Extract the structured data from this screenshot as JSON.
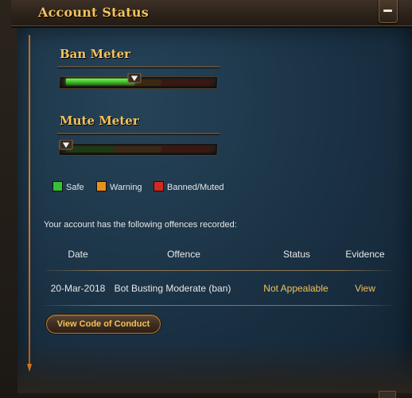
{
  "header": {
    "title": "Account Status"
  },
  "ban_meter": {
    "title": "Ban Meter",
    "level": 0.47
  },
  "mute_meter": {
    "title": "Mute Meter",
    "level": 0.0
  },
  "legend": [
    {
      "label": "Safe",
      "color": "#33c233"
    },
    {
      "label": "Warning",
      "color": "#e8921c"
    },
    {
      "label": "Banned/Muted",
      "color": "#d12a20"
    }
  ],
  "offences_text": "Your account has the following offences recorded:",
  "table": {
    "headers": [
      "Date",
      "Offence",
      "Status",
      "Evidence"
    ],
    "rows": [
      {
        "date": "20-Mar-2018",
        "offence": "Bot Busting Moderate (ban)",
        "status": "Not Appealable",
        "evidence": "View"
      }
    ]
  },
  "colors": {
    "accent_gold": "#f3c25c",
    "text": "#e6e6e6"
  },
  "buttons": {
    "code_of_conduct": "View Code of Conduct"
  },
  "icons": {
    "collapse": "minus-icon",
    "marker": "triangle-down-icon"
  }
}
